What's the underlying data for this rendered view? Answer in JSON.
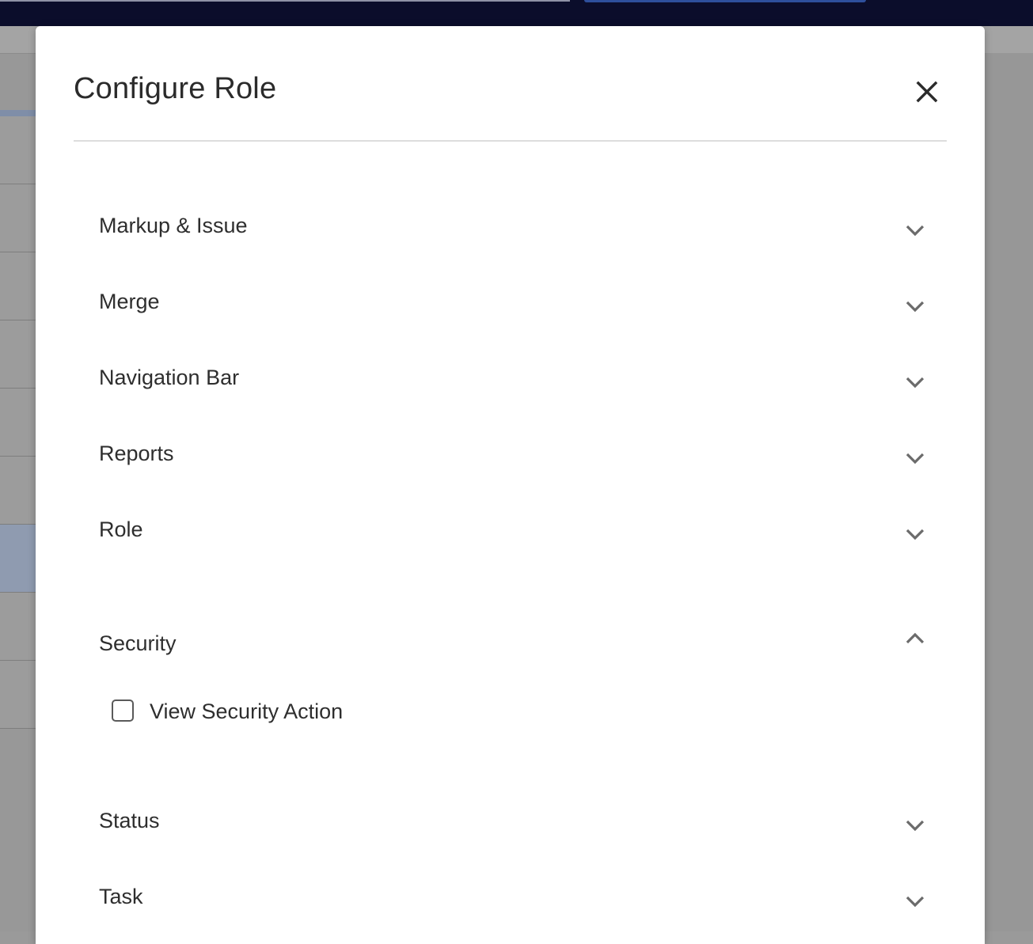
{
  "modal": {
    "title": "Configure Role",
    "close_icon": "close-icon"
  },
  "sections": [
    {
      "label": "Markup & Issue",
      "expanded": false,
      "icon": "chevron-down-icon"
    },
    {
      "label": "Merge",
      "expanded": false,
      "icon": "chevron-down-icon"
    },
    {
      "label": "Navigation Bar",
      "expanded": false,
      "icon": "chevron-down-icon"
    },
    {
      "label": "Reports",
      "expanded": false,
      "icon": "chevron-down-icon"
    },
    {
      "label": "Role",
      "expanded": false,
      "icon": "chevron-down-icon"
    },
    {
      "label": "Security",
      "expanded": true,
      "icon": "chevron-up-icon",
      "options": [
        {
          "label": "View Security Action",
          "checked": false
        }
      ]
    },
    {
      "label": "Status",
      "expanded": false,
      "icon": "chevron-down-icon"
    },
    {
      "label": "Task",
      "expanded": false,
      "icon": "chevron-down-icon"
    }
  ],
  "colors": {
    "topbar": "#0b0d2b",
    "backdrop": "#989898",
    "modal_background": "#ffffff",
    "text": "#2e2e2e",
    "chevron": "#6b6b6b"
  }
}
